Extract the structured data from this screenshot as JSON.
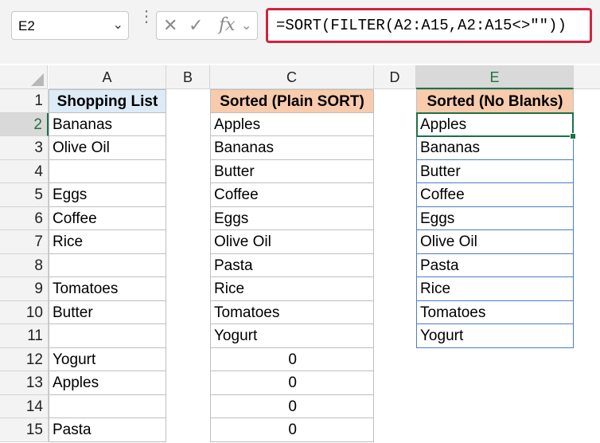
{
  "name_box": {
    "value": "E2"
  },
  "formula_bar": {
    "formula": "=SORT(FILTER(A2:A15,A2:A15<>\"\"))"
  },
  "columns": [
    "A",
    "B",
    "C",
    "D",
    "E"
  ],
  "selected_column": "E",
  "rows": [
    "1",
    "2",
    "3",
    "4",
    "5",
    "6",
    "7",
    "8",
    "9",
    "10",
    "11",
    "12",
    "13",
    "14",
    "15"
  ],
  "selected_row": "2",
  "headers": {
    "shopping": "Shopping List",
    "plain_sort": "Sorted (Plain SORT)",
    "no_blanks": "Sorted (No Blanks)"
  },
  "colors": {
    "shopping_header_fill": "#ddebf7",
    "sorted_header_fill": "#f8cbad",
    "formula_highlight": "#d1233e",
    "active_cell": "#1e7145"
  },
  "shopping_list": [
    "Bananas",
    "Olive Oil",
    "",
    "Eggs",
    "Coffee",
    "Rice",
    "",
    "Tomatoes",
    "Butter",
    "",
    "Yogurt",
    "Apples",
    "",
    "Pasta"
  ],
  "plain_sort": [
    "Apples",
    "Bananas",
    "Butter",
    "Coffee",
    "Eggs",
    "Olive Oil",
    "Pasta",
    "Rice",
    "Tomatoes",
    "Yogurt",
    "0",
    "0",
    "0",
    "0"
  ],
  "no_blanks": [
    "Apples",
    "Bananas",
    "Butter",
    "Coffee",
    "Eggs",
    "Olive Oil",
    "Pasta",
    "Rice",
    "Tomatoes",
    "Yogurt"
  ]
}
